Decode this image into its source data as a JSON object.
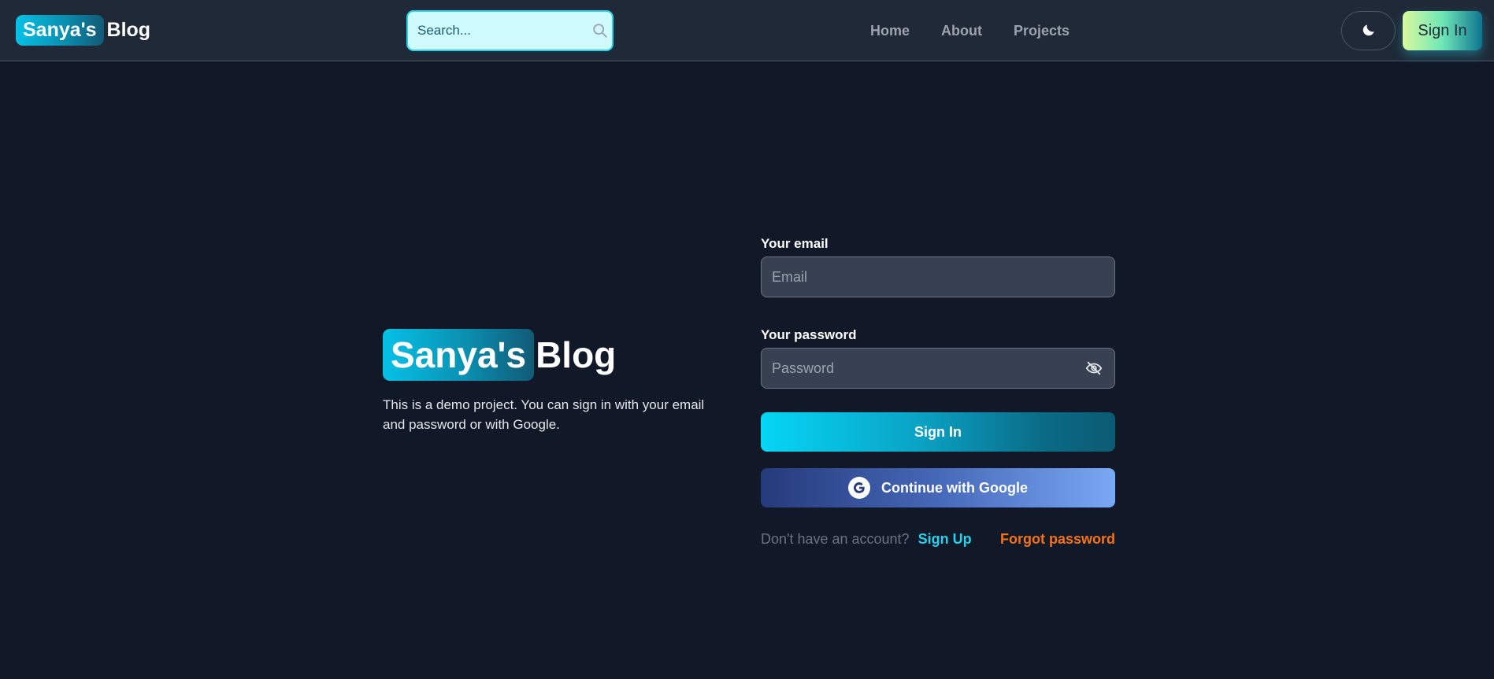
{
  "header": {
    "logo_badge": "Sanya's",
    "logo_text": "Blog",
    "search_placeholder": "Search...",
    "nav": [
      {
        "label": "Home"
      },
      {
        "label": "About"
      },
      {
        "label": "Projects"
      }
    ],
    "theme_icon": "moon-icon",
    "signin_label": "Sign In"
  },
  "intro": {
    "logo_badge": "Sanya's",
    "logo_text": "Blog",
    "description": "This is a demo project. You can sign in with your email and password or with Google."
  },
  "form": {
    "email_label": "Your email",
    "email_placeholder": "Email",
    "password_label": "Your password",
    "password_placeholder": "Password",
    "password_toggle_icon": "eye-off-icon",
    "submit_label": "Sign In",
    "google_label": "Continue with Google",
    "google_icon": "google-icon",
    "no_account_text": "Don't have an account?",
    "signup_label": "Sign Up",
    "forgot_label": "Forgot password"
  },
  "colors": {
    "background": "#111827",
    "header": "#1f2937",
    "accent_cyan": "#22d3ee",
    "forgot_orange": "#f97316"
  }
}
